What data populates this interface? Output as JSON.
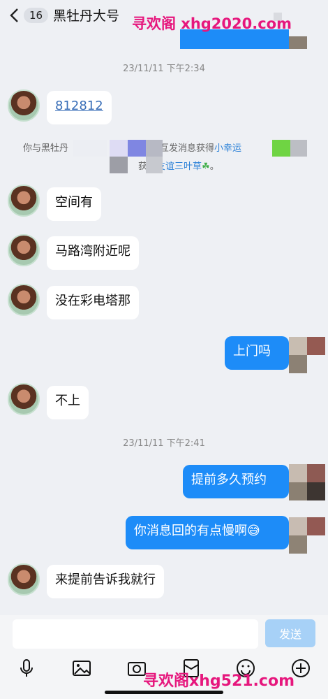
{
  "header": {
    "unread_count": "16",
    "title": "黑牡丹大号"
  },
  "watermarks": {
    "top": "寻欢阁 xhg2020.com",
    "bottom": "寻欢阁xhg521.com"
  },
  "timestamps": [
    "23/11/11 下午2:34",
    "23/11/11 下午2:41"
  ],
  "system_notice": {
    "line1_prefix": "你与黑牡丹",
    "line1_middle": "好友并互发消息获得",
    "line1_highlight": "小幸运",
    "line2_prefix": "获得",
    "line2_highlight": "友谊三叶草",
    "line2_suffix": "。"
  },
  "messages": {
    "m1": "812812",
    "m2": "空间有",
    "m3": "马路湾附近呢",
    "m4": "没在彩电塔那",
    "m5": "上门吗",
    "m6": "不上",
    "m7": "提前多久预约",
    "m8": "你消息回的有点慢啊😅",
    "m9": "来提前告诉我就行"
  },
  "input": {
    "placeholder": "",
    "send_label": "发送"
  },
  "toolbar_icons": [
    "microphone-icon",
    "image-icon",
    "camera-icon",
    "red-packet-icon",
    "emoji-icon",
    "plus-icon"
  ],
  "colors": {
    "outgoing_bubble": "#1d8cf8",
    "incoming_bubble": "#ffffff",
    "background": "#eef0f4",
    "watermark": "#e6177d",
    "send_button": "#a7d1f7"
  }
}
